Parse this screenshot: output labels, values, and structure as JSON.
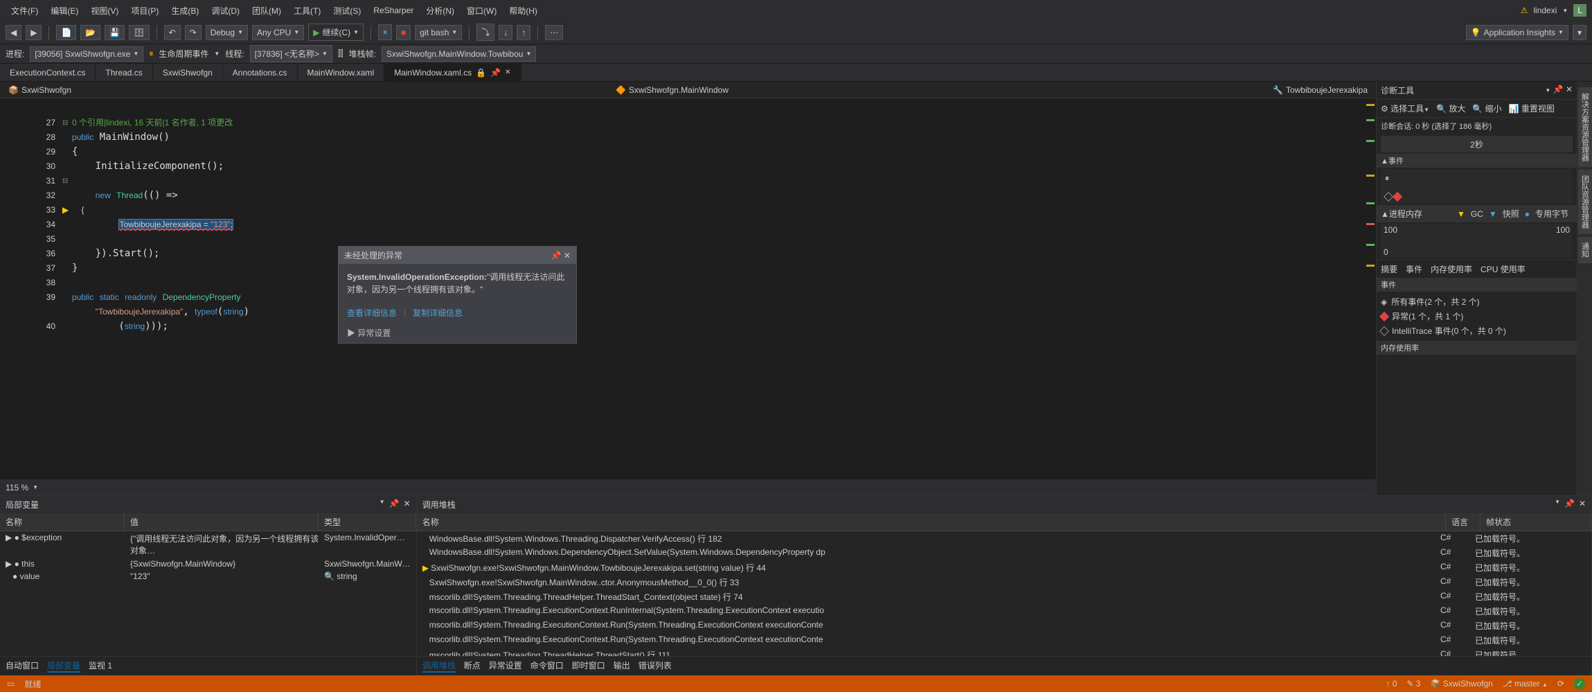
{
  "menu": {
    "items": [
      "文件(F)",
      "编辑(E)",
      "视图(V)",
      "项目(P)",
      "生成(B)",
      "调试(D)",
      "团队(M)",
      "工具(T)",
      "测试(S)",
      "ReSharper",
      "分析(N)",
      "窗口(W)",
      "帮助(H)"
    ],
    "user": "lindexi",
    "badge": "L"
  },
  "toolbar": {
    "nav_back": "◀",
    "nav_fwd": "▶",
    "config": "Debug",
    "platform": "Any CPU",
    "continue": "继续(C)",
    "git": "git bash",
    "insights": "Application Insights"
  },
  "toolbar2": {
    "process_lbl": "进程:",
    "process": "[39056] SxwiShwofgn.exe",
    "lifecycle": "生命周期事件",
    "thread_lbl": "线程:",
    "thread": "[37836] <无名称>",
    "stackframe_lbl": "堆栈帧:",
    "stackframe": "SxwiShwofgn.MainWindow.Towbibou"
  },
  "tabs": [
    {
      "label": "ExecutionContext.cs"
    },
    {
      "label": "Thread.cs"
    },
    {
      "label": "SxwiShwofgn"
    },
    {
      "label": "Annotations.cs"
    },
    {
      "label": "MainWindow.xaml"
    },
    {
      "label": "MainWindow.xaml.cs",
      "active": true,
      "lock": true
    }
  ],
  "nav": {
    "scope": "SxwiShwofgn",
    "class": "SxwiShwofgn.MainWindow",
    "member": "TowbiboujeJerexakipa"
  },
  "code": {
    "ref_info": "0 个引用|lindexi, 16 天前|1 名作者, 1 项更改",
    "lines": [
      {
        "n": 27,
        "t": "public MainWindow()"
      },
      {
        "n": 28,
        "t": "{"
      },
      {
        "n": 29,
        "t": "    InitializeComponent();"
      },
      {
        "n": 30,
        "t": ""
      },
      {
        "n": 31,
        "t": "    new Thread(() =>"
      },
      {
        "n": 32,
        "t": "    {"
      },
      {
        "n": 33,
        "t": "        TowbiboujeJerexakipa = \"123\";"
      },
      {
        "n": 34,
        "t": "    "
      },
      {
        "n": 35,
        "t": "    }).Start();"
      },
      {
        "n": 36,
        "t": "}"
      },
      {
        "n": 37,
        "t": ""
      },
      {
        "n": 38,
        "t": "public static readonly DependencyProperty                                           erty.Register("
      },
      {
        "n": 39,
        "t": "    \"TowbiboujeJerexakipa\", typeof(string)                                          efault"
      },
      {
        "n": "",
        "t": "        (string)));"
      },
      {
        "n": 40,
        "t": ""
      }
    ]
  },
  "zoom": "115 %",
  "exception": {
    "title": "未经处理的异常",
    "type": "System.InvalidOperationException:",
    "msg": "\"调用线程无法访问此对象，因为另一个线程拥有该对象。\"",
    "link1": "查看详细信息",
    "link2": "复制详细信息",
    "settings": "▶ 异常设置"
  },
  "diag": {
    "title": "诊断工具",
    "select": "选择工具",
    "zoom_in": "放大",
    "zoom_out": "缩小",
    "reset": "重置视图",
    "session": "诊断会话: 0 秒 (选择了 186 毫秒)",
    "timeline_mark": "2秒",
    "events_hd": "▲事件",
    "mem_hd": "▲进程内存",
    "gc": "GC",
    "snap": "快照",
    "heap": "专用字节",
    "mem_100a": "100",
    "mem_100b": "100",
    "mem_0": "0",
    "tabs": [
      "摘要",
      "事件",
      "内存使用率",
      "CPU 使用率"
    ],
    "events_title": "事件",
    "events": [
      {
        "ic": "◈",
        "txt": "所有事件(2 个，共 2 个)"
      },
      {
        "ic": "◆",
        "cls": "red",
        "txt": "异常(1 个，共 1 个)"
      },
      {
        "ic": "◇",
        "txt": "IntelliTrace 事件(0 个，共 0 个)"
      }
    ],
    "mem_usage": "内存使用率"
  },
  "side_tabs": [
    "解决方案资源管理器",
    "团队资源管理器",
    "通知"
  ],
  "locals": {
    "title": "局部变量",
    "cols": [
      "名称",
      "值",
      "类型"
    ],
    "rows": [
      {
        "name": "$exception",
        "val": "{\"调用线程无法访问此对象，因为另一个线程拥有该对象…",
        "type": "System.InvalidOper…"
      },
      {
        "name": "this",
        "val": "{SxwiShwofgn.MainWindow}",
        "type": "SxwiShwofgn.MainW…"
      },
      {
        "name": "value",
        "val": "\"123\"",
        "type": "string"
      }
    ],
    "tabs": [
      "自动窗口",
      "局部变量",
      "监视 1"
    ]
  },
  "callstack": {
    "title": "调用堆栈",
    "cols": [
      "名称",
      "语言",
      "帧状态"
    ],
    "rows": [
      {
        "name": "WindowsBase.dll!System.Windows.Threading.Dispatcher.VerifyAccess() 行 182",
        "lang": "C#",
        "state": "已加载符号。"
      },
      {
        "name": "WindowsBase.dll!System.Windows.DependencyObject.SetValue(System.Windows.DependencyProperty dp",
        "lang": "C#",
        "state": "已加载符号。"
      },
      {
        "name": "SxwiShwofgn.exe!SxwiShwofgn.MainWindow.TowbiboujeJerexakipa.set(string value) 行 44",
        "lang": "C#",
        "state": "已加载符号。",
        "cur": true
      },
      {
        "name": "SxwiShwofgn.exe!SxwiShwofgn.MainWindow..ctor.AnonymousMethod__0_0() 行 33",
        "lang": "C#",
        "state": "已加载符号。"
      },
      {
        "name": "mscorlib.dll!System.Threading.ThreadHelper.ThreadStart_Context(object state) 行 74",
        "lang": "C#",
        "state": "已加载符号。"
      },
      {
        "name": "mscorlib.dll!System.Threading.ExecutionContext.RunInternal(System.Threading.ExecutionContext executio",
        "lang": "C#",
        "state": "已加载符号。"
      },
      {
        "name": "mscorlib.dll!System.Threading.ExecutionContext.Run(System.Threading.ExecutionContext executionConte",
        "lang": "C#",
        "state": "已加载符号。"
      },
      {
        "name": "mscorlib.dll!System.Threading.ExecutionContext.Run(System.Threading.ExecutionContext executionConte",
        "lang": "C#",
        "state": "已加载符号。"
      },
      {
        "name": "mscorlib.dll!System.Threading.ThreadHelper.ThreadStart() 行 111",
        "lang": "C#",
        "state": "已加载符号。"
      }
    ],
    "tabs": [
      "调用堆栈",
      "断点",
      "异常设置",
      "命令窗口",
      "即时窗口",
      "输出",
      "错误列表"
    ]
  },
  "status": {
    "ready": "就绪",
    "up": "0",
    "edit": "3",
    "proj": "SxwiShwofgn",
    "branch": "master"
  }
}
